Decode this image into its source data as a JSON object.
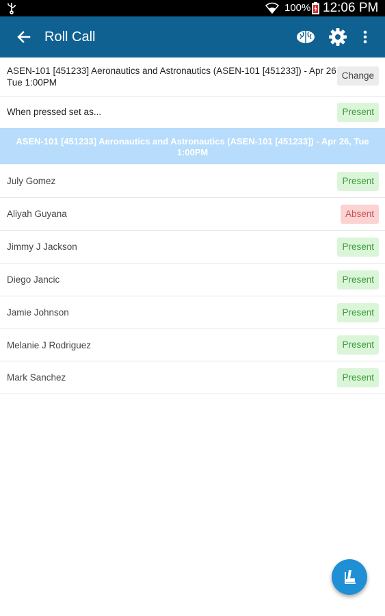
{
  "status_bar": {
    "battery": "100%",
    "time": "12:06 PM"
  },
  "app_bar": {
    "title": "Roll Call"
  },
  "course_row": {
    "text": "ASEN-101 [451233] Aeronautics and Astronautics (ASEN-101 [451233]) - Apr 26, Tue 1:00PM",
    "button": "Change"
  },
  "default_row": {
    "label": "When pressed set as...",
    "value": "Present"
  },
  "banner": {
    "text": "ASEN-101 [451233] Aeronautics and Astronautics (ASEN-101 [451233]) - Apr 26, Tue 1:00PM"
  },
  "students": [
    {
      "name": "July Gomez",
      "status": "Present"
    },
    {
      "name": "Aliyah Guyana",
      "status": "Absent"
    },
    {
      "name": "Jimmy J Jackson",
      "status": "Present"
    },
    {
      "name": "Diego Jancic",
      "status": "Present"
    },
    {
      "name": "Jamie Johnson",
      "status": "Present"
    },
    {
      "name": "Melanie J Rodriguez",
      "status": "Present"
    },
    {
      "name": "Mark Sanchez",
      "status": "Present"
    }
  ],
  "colors": {
    "app_bar": "#0f6192",
    "banner": "#b8dcfb",
    "present_bg": "#dbf5d9",
    "absent_bg": "#fbd3d3",
    "fab": "#1f8fd6"
  },
  "icons": {
    "usb": "usb-icon",
    "wifi": "wifi-icon",
    "battery": "battery-icon",
    "back": "arrow-back-icon",
    "brain": "brain-icon",
    "settings": "gear-icon",
    "more": "more-vert-icon",
    "fab": "seat-icon"
  }
}
